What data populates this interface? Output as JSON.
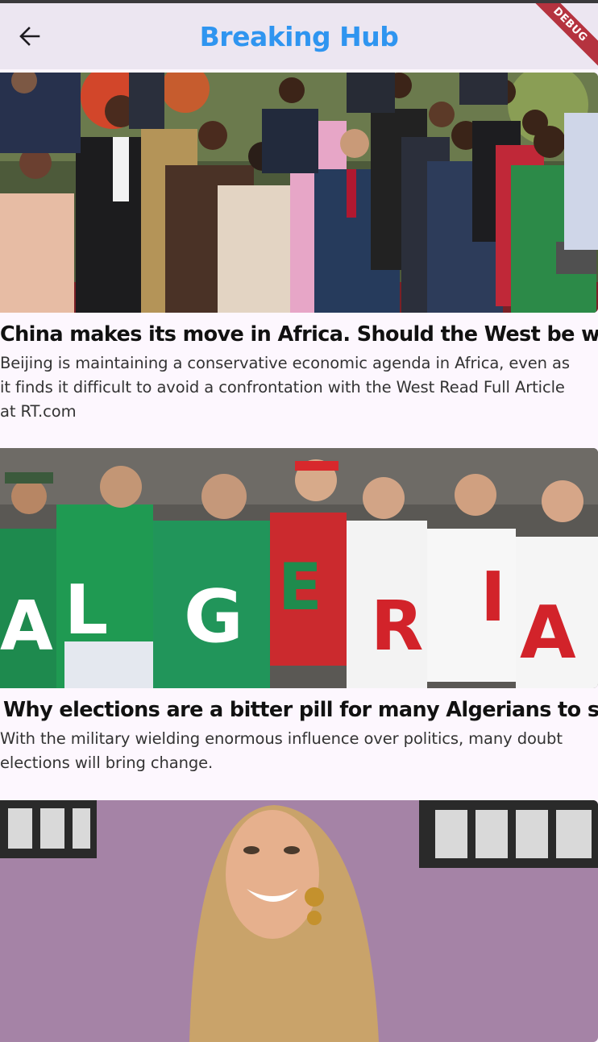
{
  "appbar": {
    "title": "Breaking Hub",
    "debug_banner": "DEBUG"
  },
  "articles": [
    {
      "headline": "China makes its move in Africa. Should the West be worried?",
      "description": "Beijing is maintaining a conservative economic agenda in Africa, even as it finds it difficult to avoid a confrontation with the West Read Full Article at RT.com"
    },
    {
      "headline": "Why elections are a bitter pill for many Algerians to swallow",
      "description": "With the military wielding enormous influence over politics, many doubt elections will bring change.",
      "shirt_letters": [
        "A",
        "L",
        "G",
        "E",
        "R",
        "I",
        "A"
      ]
    },
    {
      "headline": "",
      "description": ""
    }
  ]
}
